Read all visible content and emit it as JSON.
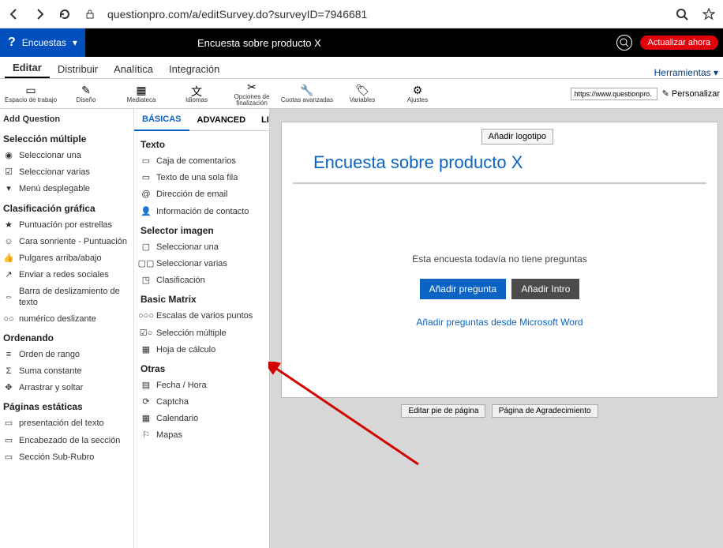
{
  "browser": {
    "url": "questionpro.com/a/editSurvey.do?surveyID=7946681"
  },
  "topbar": {
    "brand_menu": "Encuestas",
    "survey_title": "Encuesta sobre producto X",
    "update_button": "Actualizar ahora"
  },
  "nav": {
    "tabs": [
      "Editar",
      "Distribuir",
      "Analítica",
      "Integración"
    ],
    "tools_label": "Herramientas"
  },
  "toolbar": {
    "items": [
      {
        "label": "Espacio de trabajo",
        "icon": "▭"
      },
      {
        "label": "Diseño",
        "icon": "✎"
      },
      {
        "label": "Mediateca",
        "icon": "▦"
      },
      {
        "label": "Idiomas",
        "icon": "文"
      },
      {
        "label": "Opciones de finalización",
        "icon": "✂"
      },
      {
        "label": "Cuotas avanzadas",
        "icon": "🔧"
      },
      {
        "label": "Variables",
        "icon": "🏷"
      },
      {
        "label": "Ajustes",
        "icon": "⚙"
      }
    ],
    "url_preview": "https://www.questionpro.",
    "personalize": "Personalizar"
  },
  "sidebar": {
    "add_question": "Add Question",
    "groups": [
      {
        "title": "Selección múltiple",
        "items": [
          "Seleccionar una",
          "Seleccionar varias",
          "Menú desplegable"
        ]
      },
      {
        "title": "Clasificación gráfica",
        "items": [
          "Puntuación por estrellas",
          "Cara sonriente - Puntuación",
          "Pulgares arriba/abajo",
          "Enviar a redes sociales",
          "Barra de deslizamiento de texto",
          "numérico deslizante"
        ]
      },
      {
        "title": "Ordenando",
        "items": [
          "Orden de rango",
          "Suma constante",
          "Arrastrar y soltar"
        ]
      },
      {
        "title": "Páginas estáticas",
        "items": [
          "presentación del texto",
          "Encabezado de la sección",
          "Sección Sub-Rubro"
        ]
      }
    ]
  },
  "midcol": {
    "tabs": [
      "BÁSICAS",
      "ADVANCED",
      "LIBRARY"
    ],
    "groups": [
      {
        "title": "Texto",
        "items": [
          "Caja de comentarios",
          "Texto de una sola fila",
          "Dirección de email",
          "Información de contacto"
        ]
      },
      {
        "title": "Selector imagen",
        "items": [
          "Seleccionar una",
          "Seleccionar varias",
          "Clasificación"
        ]
      },
      {
        "title": "Basic Matrix",
        "items": [
          "Escalas de varios puntos",
          "Selección múltiple",
          "Hoja de cálculo"
        ]
      },
      {
        "title": "Otras",
        "items": [
          "Fecha / Hora",
          "Captcha",
          "Calendario",
          "Mapas"
        ]
      }
    ]
  },
  "canvas": {
    "add_logo": "Añadir logotipo",
    "heading": "Encuesta sobre producto X",
    "empty_msg": "Esta encuesta todavía no tiene preguntas",
    "add_question_btn": "Añadir pregunta",
    "add_intro_btn": "Añadir Intro",
    "word_link": "Añadir preguntas desde Microsoft Word",
    "edit_footer": "Editar pie de página",
    "thanks_page": "Página de Agradecimiento"
  }
}
